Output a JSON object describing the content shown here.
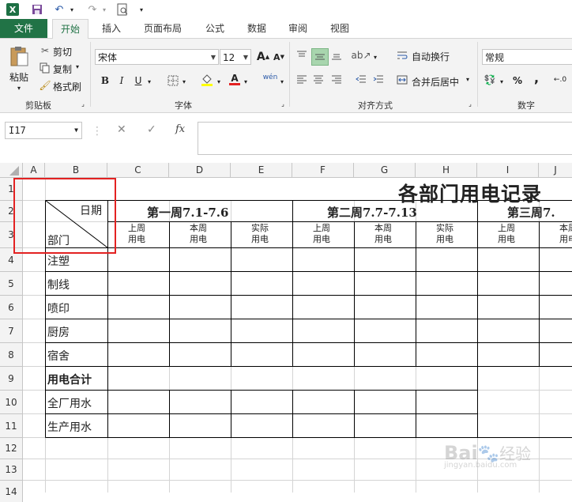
{
  "quick_access": {
    "logo_text": "X",
    "save": "save-icon",
    "undo": "undo-icon",
    "redo": "redo-icon",
    "preview": "print-preview-icon"
  },
  "tabs": [
    "文件",
    "开始",
    "插入",
    "页面布局",
    "公式",
    "数据",
    "审阅",
    "视图"
  ],
  "ribbon": {
    "clipboard": {
      "paste": "粘贴",
      "cut": "剪切",
      "copy": "复制",
      "format_painter": "格式刷",
      "label": "剪贴板"
    },
    "font": {
      "name": "宋体",
      "size": "12",
      "label": "字体",
      "bold": "B",
      "italic": "I",
      "underline": "U",
      "grow": "A",
      "shrink": "A",
      "font_color": "A",
      "phonetic": "wén"
    },
    "alignment": {
      "wrap": "自动换行",
      "merge": "合并后居中",
      "label": "对齐方式"
    },
    "number": {
      "format": "常规",
      "label": "数字",
      "percent": "%",
      "comma": ","
    }
  },
  "formula_bar": {
    "name_box": "I17",
    "fx": "fx",
    "cancel": "✕",
    "enter": "✓",
    "value": ""
  },
  "columns": [
    "A",
    "B",
    "C",
    "D",
    "E",
    "F",
    "G",
    "H",
    "I",
    "J"
  ],
  "rows": [
    "1",
    "2",
    "3",
    "4",
    "5",
    "6",
    "7",
    "8",
    "9",
    "10",
    "11",
    "12",
    "13",
    "14"
  ],
  "sheet": {
    "title": "各部门用电记录",
    "diag_top": "日期",
    "diag_bottom": "部门",
    "weeks": [
      "第一周7.1-7.6",
      "第二周7.7-7.13",
      "第三周7."
    ],
    "sub_headers": [
      [
        "上周",
        "用电"
      ],
      [
        "本周",
        "用电"
      ],
      [
        "实际",
        "用电"
      ],
      [
        "上周",
        "用电"
      ],
      [
        "本周",
        "用电"
      ],
      [
        "实际",
        "用电"
      ],
      [
        "上周",
        "用电"
      ],
      [
        "本周",
        "用电"
      ]
    ],
    "departments": [
      "注塑",
      "制线",
      "喷印",
      "厨房",
      "宿舍"
    ],
    "total_label": "用电合计",
    "extra_rows": [
      "全厂用水",
      "生产用水"
    ]
  },
  "watermark": {
    "brand": "Bai",
    "brand2": "经验",
    "url": "jingyan.baidu.com"
  },
  "colors": {
    "excel_green": "#217346",
    "highlight": "#e32222",
    "grid": "#d4d4d4"
  }
}
